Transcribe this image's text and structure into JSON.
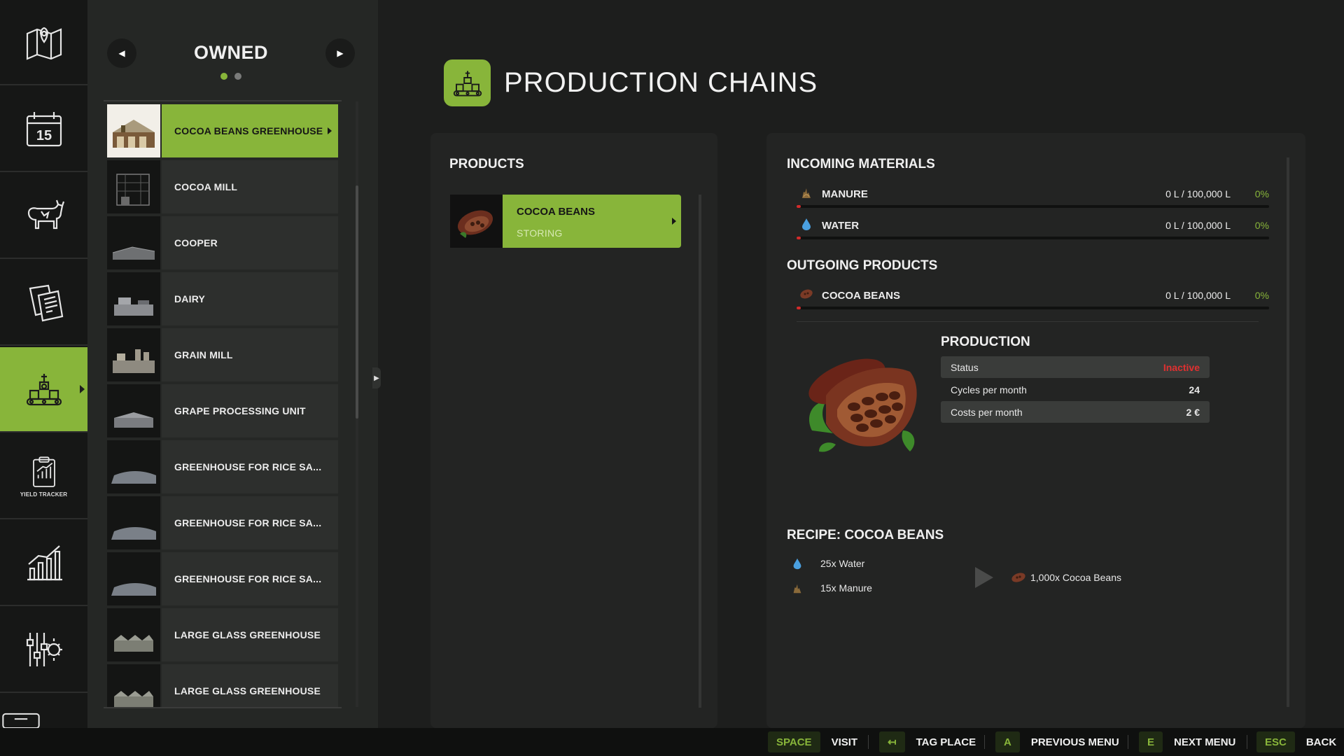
{
  "rail": {
    "items": [
      {
        "icon": "map-icon"
      },
      {
        "icon": "calendar-icon",
        "day": "15"
      },
      {
        "icon": "cow-icon"
      },
      {
        "icon": "contracts-icon"
      },
      {
        "icon": "production-icon"
      },
      {
        "icon": "yield-tracker-icon",
        "sub": "YIELD TRACKER"
      },
      {
        "icon": "statistics-icon"
      },
      {
        "icon": "settings-icon"
      },
      {
        "icon": "controls-icon"
      }
    ]
  },
  "list": {
    "title": "OWNED",
    "items": [
      {
        "label": "COCOA BEANS GREENHOUSE"
      },
      {
        "label": "COCOA MILL"
      },
      {
        "label": "COOPER"
      },
      {
        "label": "DAIRY"
      },
      {
        "label": "GRAIN MILL"
      },
      {
        "label": "GRAPE PROCESSING UNIT"
      },
      {
        "label": "GREENHOUSE FOR RICE SA..."
      },
      {
        "label": "GREENHOUSE FOR RICE SA..."
      },
      {
        "label": "GREENHOUSE FOR RICE SA..."
      },
      {
        "label": "LARGE GLASS GREENHOUSE"
      },
      {
        "label": "LARGE GLASS GREENHOUSE"
      }
    ]
  },
  "header": {
    "title": "PRODUCTION CHAINS"
  },
  "products": {
    "heading": "PRODUCTS",
    "items": [
      {
        "name": "COCOA BEANS",
        "status": "STORING"
      }
    ]
  },
  "incoming": {
    "heading": "INCOMING MATERIALS",
    "items": [
      {
        "name": "MANURE",
        "amount": "0 L / 100,000 L",
        "percent": "0%",
        "fill": 0
      },
      {
        "name": "WATER",
        "amount": "0 L / 100,000 L",
        "percent": "0%",
        "fill": 0
      }
    ]
  },
  "outgoing": {
    "heading": "OUTGOING PRODUCTS",
    "items": [
      {
        "name": "COCOA BEANS",
        "amount": "0 L / 100,000 L",
        "percent": "0%",
        "fill": 0
      }
    ]
  },
  "production": {
    "heading": "PRODUCTION",
    "rows": [
      {
        "label": "Status",
        "value": "Inactive"
      },
      {
        "label": "Cycles per month",
        "value": "24"
      },
      {
        "label": "Costs per month",
        "value": "2 €"
      }
    ]
  },
  "recipe": {
    "heading": "RECIPE: COCOA BEANS",
    "inputs": [
      {
        "label": "25x Water",
        "icon": "water-drop-icon"
      },
      {
        "label": "15x Manure",
        "icon": "manure-icon"
      }
    ],
    "output": {
      "label": "1,000x Cocoa Beans",
      "icon": "cocoa-beans-icon"
    }
  },
  "hints": [
    {
      "key": "SPACE",
      "action": "VISIT"
    },
    {
      "key": "↤",
      "action": "TAG PLACE"
    },
    {
      "key": "A",
      "action": "PREVIOUS MENU"
    },
    {
      "key": "E",
      "action": "NEXT MENU"
    },
    {
      "key": "ESC",
      "action": "BACK"
    }
  ],
  "colors": {
    "accent": "#88b53a",
    "inactive": "#e03030",
    "bar_fill": "#d22b2b"
  }
}
